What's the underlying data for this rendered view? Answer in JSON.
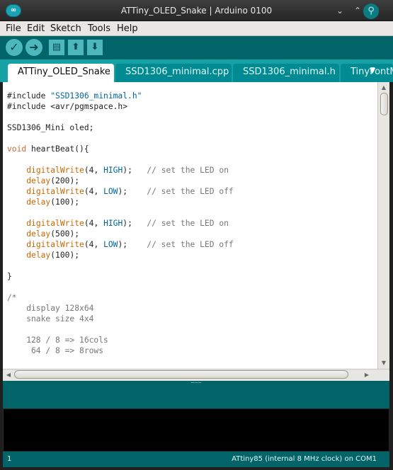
{
  "window": {
    "title": "ATTiny_OLED_Snake | Arduino 0100",
    "logo_text": "∞",
    "controls": {
      "minimize": "⌄",
      "maximize": "⌃",
      "close": "✕"
    }
  },
  "menu": [
    "File",
    "Edit",
    "Sketch",
    "Tools",
    "Help"
  ],
  "toolbar": {
    "verify_icon": "✓",
    "upload_icon": "➜",
    "new_icon": "▤",
    "open_icon": "⬆",
    "save_icon": "⬇",
    "serial_monitor_icon": "⚲"
  },
  "tabs": [
    {
      "label": "ATTiny_OLED_Snake",
      "active": true
    },
    {
      "label": "SSD1306_minimal.cpp",
      "active": false
    },
    {
      "label": "SSD1306_minimal.h",
      "active": false
    },
    {
      "label": "TinyFontM",
      "active": false
    }
  ],
  "tab_menu_icon": "▼",
  "code": [
    [
      [
        "#include ",
        ""
      ],
      [
        "\"SSD1306_minimal.h\"",
        "str"
      ]
    ],
    [
      [
        "#include <avr/pgmspace.h>",
        ""
      ]
    ],
    [],
    [
      [
        "SSD1306_Mini oled;",
        ""
      ]
    ],
    [],
    [
      [
        "void",
        "kw"
      ],
      [
        " heartBeat(){",
        ""
      ]
    ],
    [],
    [
      [
        "    ",
        ""
      ],
      [
        "digitalWrite",
        "fn"
      ],
      [
        "(4, ",
        ""
      ],
      [
        "HIGH",
        "const"
      ],
      [
        ");   ",
        ""
      ],
      [
        "// set the LED on",
        "com"
      ]
    ],
    [
      [
        "    ",
        ""
      ],
      [
        "delay",
        "fn"
      ],
      [
        "(200);",
        ""
      ]
    ],
    [
      [
        "    ",
        ""
      ],
      [
        "digitalWrite",
        "fn"
      ],
      [
        "(4, ",
        ""
      ],
      [
        "LOW",
        "const"
      ],
      [
        ");    ",
        ""
      ],
      [
        "// set the LED off",
        "com"
      ]
    ],
    [
      [
        "    ",
        ""
      ],
      [
        "delay",
        "fn"
      ],
      [
        "(100);",
        ""
      ]
    ],
    [],
    [
      [
        "    ",
        ""
      ],
      [
        "digitalWrite",
        "fn"
      ],
      [
        "(4, ",
        ""
      ],
      [
        "HIGH",
        "const"
      ],
      [
        ");   ",
        ""
      ],
      [
        "// set the LED on",
        "com"
      ]
    ],
    [
      [
        "    ",
        ""
      ],
      [
        "delay",
        "fn"
      ],
      [
        "(500);",
        ""
      ]
    ],
    [
      [
        "    ",
        ""
      ],
      [
        "digitalWrite",
        "fn"
      ],
      [
        "(4, ",
        ""
      ],
      [
        "LOW",
        "const"
      ],
      [
        ");    ",
        ""
      ],
      [
        "// set the LED off",
        "com"
      ]
    ],
    [
      [
        "    ",
        ""
      ],
      [
        "delay",
        "fn"
      ],
      [
        "(100);",
        ""
      ]
    ],
    [],
    [
      [
        "}",
        ""
      ]
    ],
    [],
    [
      [
        "/*",
        "com"
      ]
    ],
    [
      [
        "    display 128x64",
        "com"
      ]
    ],
    [
      [
        "    snake size 4x4",
        "com"
      ]
    ],
    [],
    [
      [
        "    128 / 8 => 16cols",
        "com"
      ]
    ],
    [
      [
        "     64 / 8 => 8rows",
        "com"
      ]
    ]
  ],
  "scroll_arrows": {
    "up": "▲",
    "down": "▼",
    "left": "◀",
    "right": "▶"
  },
  "status": {
    "line_number": "1",
    "board": "ATtiny85 (internal 8 MHz clock) on COM1"
  }
}
